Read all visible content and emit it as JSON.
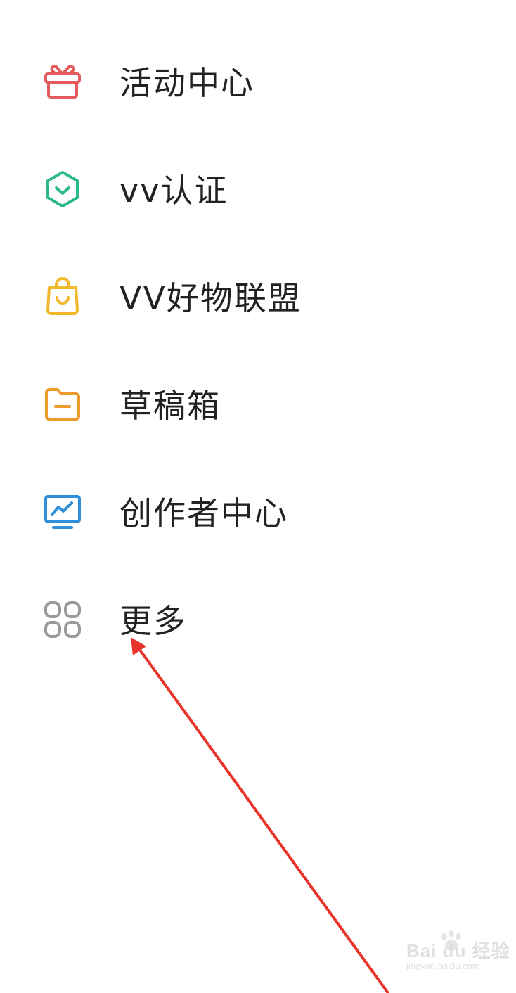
{
  "menu": {
    "items": [
      {
        "label": "活动中心",
        "icon": "gift-icon",
        "color": "#e35b5b"
      },
      {
        "label": "vv认证",
        "icon": "verified-shield-icon",
        "color": "#2bb98a"
      },
      {
        "label": "VV好物联盟",
        "icon": "shopping-bag-icon",
        "color": "#f0b82a"
      },
      {
        "label": "草稿箱",
        "icon": "folder-icon",
        "color": "#ef9a2c"
      },
      {
        "label": "创作者中心",
        "icon": "monitor-chart-icon",
        "color": "#2f8fd8"
      },
      {
        "label": "更多",
        "icon": "grid-icon",
        "color": "#9a9a9a"
      }
    ]
  },
  "annotation": {
    "arrow_color": "#e8342b"
  },
  "watermark": {
    "brand": "Bai du 经验",
    "url": "jingyan.baidu.com"
  }
}
